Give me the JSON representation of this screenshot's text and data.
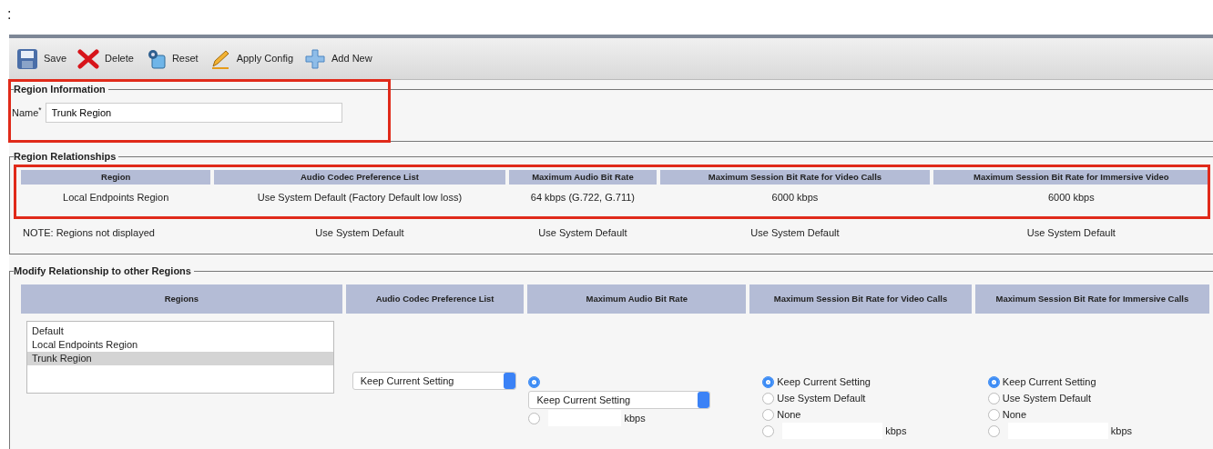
{
  "top_mark": ":",
  "toolbar": [
    {
      "kind": "save",
      "label": "Save"
    },
    {
      "kind": "delete",
      "label": "Delete"
    },
    {
      "kind": "reset",
      "label": "Reset"
    },
    {
      "kind": "apply",
      "label": "Apply Config"
    },
    {
      "kind": "add",
      "label": "Add New"
    }
  ],
  "region_information": {
    "legend": "Region Information",
    "highlighted": true,
    "name_label": "Name",
    "required_mark": "*",
    "name_value": "Trunk Region"
  },
  "region_relationships": {
    "legend": "Region Relationships",
    "highlighted": true,
    "columns": [
      "Region",
      "Audio Codec Preference List",
      "Maximum Audio Bit Rate",
      "Maximum Session Bit Rate for Video Calls",
      "Maximum Session Bit Rate for Immersive Video"
    ],
    "rows": [
      [
        "Local Endpoints Region",
        "Use System Default (Factory Default low loss)",
        "64 kbps (G.722, G.711)",
        "6000 kbps",
        "6000 kbps"
      ]
    ],
    "note_row": [
      "NOTE: Regions not displayed",
      "Use System Default",
      "Use System Default",
      "Use System Default",
      "Use System Default"
    ]
  },
  "modify_relationship": {
    "legend": "Modify Relationship to other Regions",
    "columns": [
      "Regions",
      "Audio Codec Preference List",
      "Maximum Audio Bit Rate",
      "Maximum Session Bit Rate for Video Calls",
      "Maximum Session Bit Rate for Immersive Calls"
    ],
    "regions_list": [
      {
        "label": "Default",
        "selected": false
      },
      {
        "label": "Local Endpoints Region",
        "selected": false
      },
      {
        "label": "Trunk Region",
        "selected": true
      }
    ],
    "audio_codec_select": "Keep Current Setting",
    "audio_bit_rate": [
      {
        "kind": "select",
        "value": "Keep Current Setting",
        "selected": true
      },
      {
        "kind": "input",
        "unit": "kbps",
        "selected": false
      }
    ],
    "video_bit_rate": [
      {
        "kind": "label",
        "label": "Keep Current Setting",
        "selected": true
      },
      {
        "kind": "label",
        "label": "Use System Default",
        "selected": false
      },
      {
        "kind": "label",
        "label": "None",
        "selected": false
      },
      {
        "kind": "input",
        "unit": "kbps",
        "selected": false
      }
    ],
    "immersive_bit_rate": [
      {
        "kind": "label",
        "label": "Keep Current Setting",
        "selected": true
      },
      {
        "kind": "label",
        "label": "Use System Default",
        "selected": false
      },
      {
        "kind": "label",
        "label": "None",
        "selected": false
      },
      {
        "kind": "input",
        "unit": "kbps",
        "selected": false
      }
    ]
  }
}
